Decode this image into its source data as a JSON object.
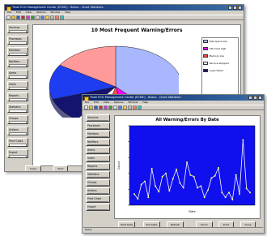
{
  "window1": {
    "title": "Tivoli ECG Management Center (ECMC) - Bravo - Chart Statistics",
    "menu": [
      "File",
      "Edit",
      "View",
      "Options",
      "Window",
      "Help"
    ],
    "sidebar": [
      "Services",
      "Processes",
      "Monitors",
      "Notifiers",
      "Alerts",
      "Users",
      "Reports",
      "Statistics",
      "Groups",
      "Actions",
      "Print Chart",
      "Export"
    ],
    "bottom_buttons": [
      "Close",
      "Print"
    ],
    "chart_data": {
      "type": "pie",
      "title": "10 Most Frequent Warning/Errors",
      "legend": [
        "Disk space low",
        "CPU load high",
        "Memory low",
        "Service stopped",
        "Login failed"
      ],
      "colors": [
        "#a9b7ff",
        "#ff00ff",
        "#ff4a4a",
        "#ffffff",
        "#14146e",
        "#1e3cf0",
        "#ff9a9a"
      ],
      "values": [
        38,
        9,
        7,
        6,
        10,
        14,
        16
      ]
    }
  },
  "window2": {
    "title": "Tivoli ECG Management Center (ECMC) - Bravo - Chart Statistics",
    "menu": [
      "File",
      "Edit",
      "View",
      "Options",
      "Window",
      "Help"
    ],
    "sidebar": [
      "Services",
      "Processes",
      "Monitors",
      "Notifiers",
      "Alerts",
      "Users",
      "Reports",
      "Statistics",
      "Groups",
      "Actions",
      "Print Chart",
      "Export"
    ],
    "bottom_buttons": [
      "Start Date",
      "End Date",
      "Refresh",
      "Zoom",
      "Print",
      "Close"
    ],
    "status_text": "Ready",
    "chart_data": {
      "type": "line",
      "title": "All Warning/Errors By Date",
      "xlabel": "Date",
      "ylabel": "Count",
      "ylim": [
        0,
        100
      ],
      "background": "#1010ee",
      "line_color": "#ffffff",
      "values": [
        14,
        8,
        26,
        30,
        10,
        46,
        24,
        17,
        36,
        40,
        18,
        33,
        45,
        28,
        22,
        54,
        38,
        36,
        22,
        24,
        10,
        19,
        34,
        37,
        47,
        16,
        10,
        16,
        7,
        38,
        14,
        82,
        21,
        16
      ]
    }
  }
}
